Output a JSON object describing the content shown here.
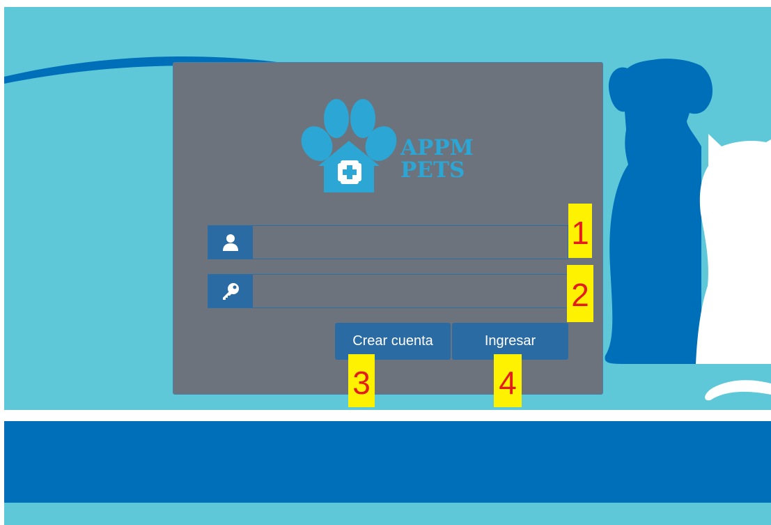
{
  "app": {
    "brand_line1": "APPM",
    "brand_line2": "PETS"
  },
  "login": {
    "username_value": "",
    "password_value": "",
    "create_account_label": "Crear cuenta",
    "login_label": "Ingresar"
  },
  "annotations": [
    "1",
    "2",
    "3",
    "4"
  ],
  "icons": {
    "user": "user-icon",
    "password": "key-icon",
    "logo": "paw-house-plus-logo",
    "dog": "dog-silhouette",
    "cat": "cat-silhouette"
  },
  "colors": {
    "background": "#5ec8d9",
    "card": "#6c737c",
    "accent": "#2b6ba4",
    "footer": "#006fba",
    "brand": "#2ba6d5",
    "marker_bg": "#fff200",
    "marker_text": "#e51b1b"
  }
}
